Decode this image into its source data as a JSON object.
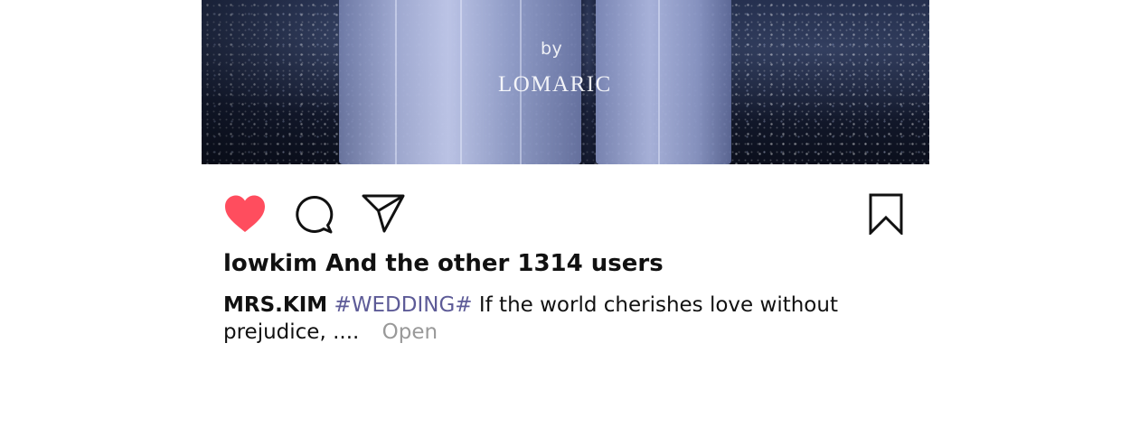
{
  "post": {
    "photo": {
      "overlay_by": "by",
      "overlay_brand": "LOMARIC"
    },
    "actions": {
      "like_icon": "heart-filled-icon",
      "comment_icon": "comment-bubble-icon",
      "share_icon": "paper-plane-icon",
      "save_icon": "bookmark-icon",
      "like_color": "#ff4d5e"
    },
    "likes_text": "lowkim And the other 1314 users",
    "caption": {
      "author": "MRS.KIM",
      "hashtag": "#WEDDING#",
      "text": "If the world cherishes love without prejudice, ....",
      "more_label": "Open"
    },
    "colors": {
      "hashtag": "#5d5b97",
      "more": "#999999"
    }
  }
}
